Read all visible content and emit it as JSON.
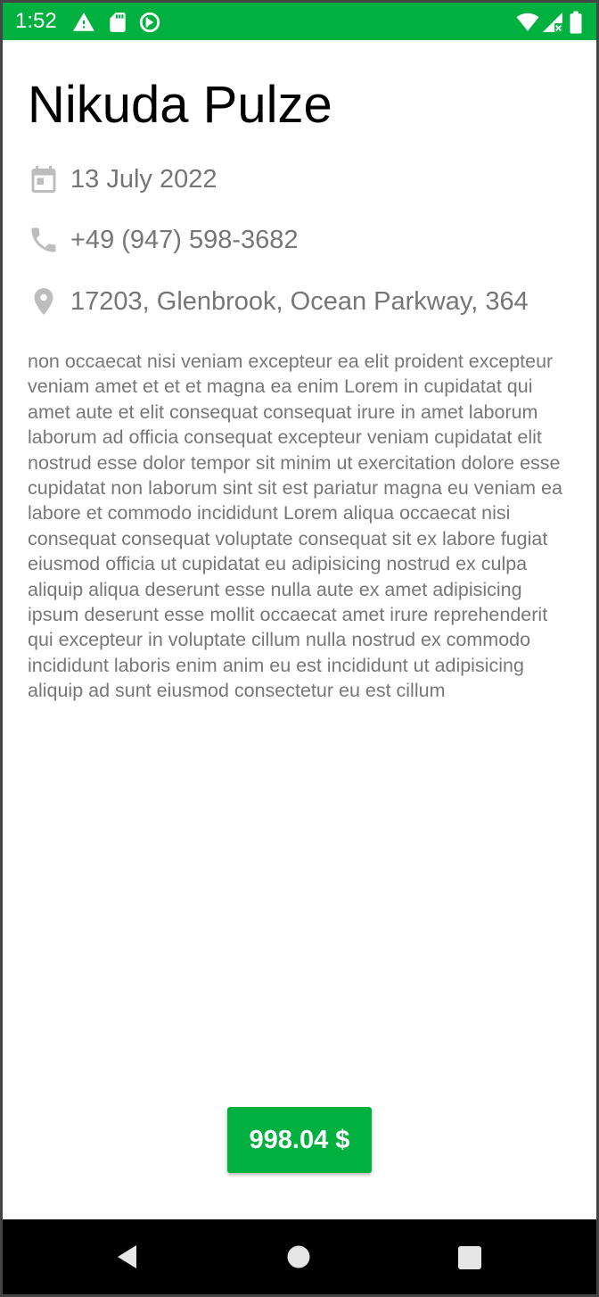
{
  "status_bar": {
    "time": "1:52",
    "left_icons": [
      "warning-icon",
      "sd-card-icon",
      "sync-icon"
    ],
    "right_icons": [
      "wifi-icon",
      "cellular-signal-icon",
      "battery-icon"
    ],
    "background_color": "#00B140"
  },
  "event": {
    "name": "Nikuda Pulze",
    "date": "13 July 2022",
    "phone": "+49 (947) 598-3682",
    "address": "17203, Glenbrook, Ocean Parkway, 364",
    "description": "non occaecat nisi veniam excepteur ea elit proident excepteur veniam amet et et et magna ea enim Lorem in cupidatat qui amet aute et elit consequat consequat irure in amet laborum laborum ad officia consequat excepteur veniam cupidatat elit nostrud esse dolor tempor sit minim ut exercitation dolore esse cupidatat non laborum sint sit est pariatur magna eu veniam ea labore et commodo incididunt Lorem aliqua occaecat nisi consequat consequat voluptate consequat sit ex labore fugiat eiusmod officia ut cupidatat eu adipisicing nostrud ex culpa aliquip aliqua deserunt esse nulla aute ex amet adipisicing ipsum deserunt esse mollit occaecat amet irure reprehenderit qui excepteur in voluptate cillum nulla nostrud ex commodo incididunt laboris enim anim eu est incididunt ut adipisicing aliquip ad sunt eiusmod consectetur eu est cillum",
    "price_label": "998.04 $"
  },
  "icons": {
    "date": "calendar-icon",
    "phone": "phone-icon",
    "address": "location-pin-icon"
  },
  "nav_bar": {
    "buttons": [
      "back-icon",
      "home-icon",
      "recents-icon"
    ]
  },
  "colors": {
    "accent": "#00B140",
    "secondary_text": "#767676",
    "icon_gray": "#BDBDBD"
  }
}
